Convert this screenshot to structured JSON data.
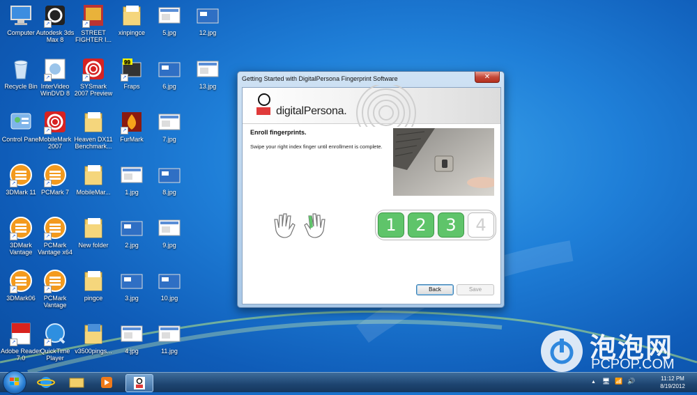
{
  "desktop": {
    "icons": [
      {
        "label": "Computer"
      },
      {
        "label": "Autodesk 3ds Max 8"
      },
      {
        "label": "STREET FIGHTER I..."
      },
      {
        "label": "xinpingce"
      },
      {
        "label": "5.jpg"
      },
      {
        "label": "12.jpg"
      },
      {
        "label": "Recycle Bin"
      },
      {
        "label": "InterVideo WinDVD 8"
      },
      {
        "label": "SYSmark 2007 Preview"
      },
      {
        "label": "Fraps"
      },
      {
        "label": "6.jpg"
      },
      {
        "label": "13.jpg"
      },
      {
        "label": "Control Panel"
      },
      {
        "label": "MobileMark 2007"
      },
      {
        "label": "Heaven DX11 Benchmark..."
      },
      {
        "label": "FurMark"
      },
      {
        "label": "7.jpg"
      },
      {
        "label": "3DMark 11"
      },
      {
        "label": "PCMark 7"
      },
      {
        "label": "MobileMar..."
      },
      {
        "label": "1.jpg"
      },
      {
        "label": "8.jpg"
      },
      {
        "label": "3DMark Vantage"
      },
      {
        "label": "PCMark Vantage x64"
      },
      {
        "label": "New folder"
      },
      {
        "label": "2.jpg"
      },
      {
        "label": "9.jpg"
      },
      {
        "label": "3DMark06"
      },
      {
        "label": "PCMark Vantage"
      },
      {
        "label": "pingce"
      },
      {
        "label": "3.jpg"
      },
      {
        "label": "10.jpg"
      },
      {
        "label": "Adobe Reader 7.0"
      },
      {
        "label": "QuickTime Player"
      },
      {
        "label": "v3500pings..."
      },
      {
        "label": "4.jpg"
      },
      {
        "label": "11.jpg"
      }
    ]
  },
  "dialog": {
    "title": "Getting Started with DigitalPersona Fingerprint Software",
    "close_label": "✕",
    "brand": "digitalPersona.",
    "heading": "Enroll fingerprints.",
    "instruction": "Swipe your right index finger until enrollment is complete.",
    "steps": [
      {
        "label": "1",
        "done": true
      },
      {
        "label": "2",
        "done": true
      },
      {
        "label": "3",
        "done": true
      },
      {
        "label": "4",
        "done": false
      }
    ],
    "back_label": "Back",
    "save_label": "Save"
  },
  "taskbar": {
    "time": "11:12 PM",
    "date": "8/19/2012",
    "tray_icons": [
      "▲",
      "🖥",
      "📶",
      "🔊"
    ]
  },
  "watermark": {
    "text": "泡泡网",
    "sub": "PCPOP.COM"
  },
  "colors": {
    "step_done": "#5fc46a",
    "brand_red": "#e03a3a",
    "desktop_blue": "#1f7fd8"
  }
}
